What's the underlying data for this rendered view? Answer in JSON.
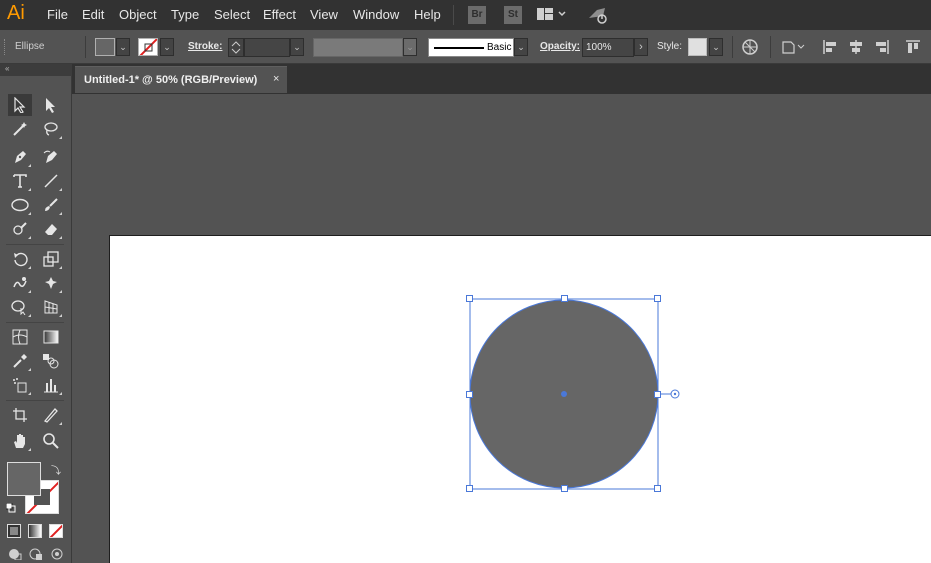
{
  "app": {
    "logo": "Ai",
    "accent": "#ff9a00"
  },
  "menu": {
    "items": [
      "File",
      "Edit",
      "Object",
      "Type",
      "Select",
      "Effect",
      "View",
      "Window",
      "Help"
    ],
    "bridge_button": "Br",
    "stock_button": "St"
  },
  "control_bar": {
    "selection_label": "Ellipse",
    "fill_color": "#666666",
    "stroke_label": "Stroke:",
    "stroke_profile": "Basic",
    "opacity_label": "Opacity:",
    "opacity_value": "100%",
    "style_label": "Style:"
  },
  "document": {
    "tab_title": "Untitled-1* @ 50% (RGB/Preview)",
    "close_glyph": "×"
  },
  "toolbar": {
    "fill_swatch_color": "#666666",
    "stroke_swatch": "none"
  },
  "canvas": {
    "artboard_color": "#ffffff",
    "ellipse_fill": "#666666",
    "selection_color": "#4a78d8"
  }
}
